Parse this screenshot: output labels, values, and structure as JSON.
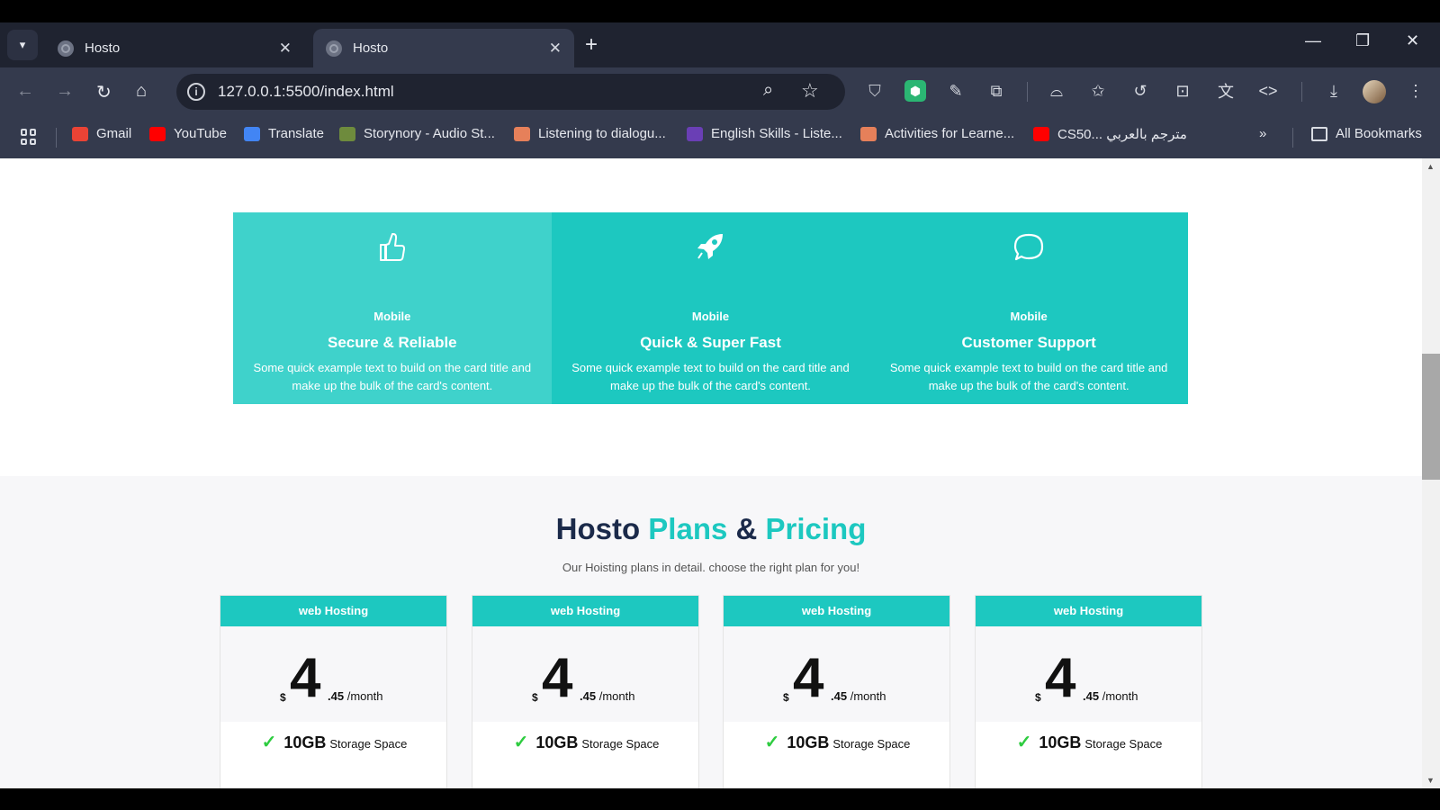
{
  "browser": {
    "tabs": [
      {
        "title": "Hosto"
      },
      {
        "title": "Hosto"
      }
    ],
    "url": "127.0.0.1:5500/index.html",
    "bookmarks": [
      {
        "label": "Gmail"
      },
      {
        "label": "YouTube"
      },
      {
        "label": "Translate"
      },
      {
        "label": "Storynory - Audio St..."
      },
      {
        "label": "Listening to dialogu..."
      },
      {
        "label": "English Skills - Liste..."
      },
      {
        "label": "Activities for Learne..."
      },
      {
        "label": "CS50... مترجم بالعربي"
      }
    ],
    "all_bookmarks": "All Bookmarks"
  },
  "features": [
    {
      "icon": "thumbs-up-icon",
      "subtitle": "Mobile",
      "title": "Secure & Reliable",
      "text": "Some quick example text to build on the card title and make up the bulk of the card's content."
    },
    {
      "icon": "rocket-icon",
      "subtitle": "Mobile",
      "title": "Quick & Super Fast",
      "text": "Some quick example text to build on the card title and make up the bulk of the card's content."
    },
    {
      "icon": "chat-bubble-icon",
      "subtitle": "Mobile",
      "title": "Customer Support",
      "text": "Some quick example text to build on the card title and make up the bulk of the card's content."
    }
  ],
  "pricing": {
    "heading_part1": "Hosto ",
    "heading_part2": "Plans",
    "heading_part3": " & ",
    "heading_part4": "Pricing",
    "subheading": "Our Hoisting plans in detail. choose the right plan for you!",
    "plans": [
      {
        "name": "web Hosting",
        "currency": "$",
        "price": "4",
        "cents": ".45",
        "period": "/month",
        "storage": "10GB",
        "storage_label": "Storage Space"
      },
      {
        "name": "web Hosting",
        "currency": "$",
        "price": "4",
        "cents": ".45",
        "period": "/month",
        "storage": "10GB",
        "storage_label": "Storage Space"
      },
      {
        "name": "web Hosting",
        "currency": "$",
        "price": "4",
        "cents": ".45",
        "period": "/month",
        "storage": "10GB",
        "storage_label": "Storage Space"
      },
      {
        "name": "web Hosting",
        "currency": "$",
        "price": "4",
        "cents": ".45",
        "period": "/month",
        "storage": "10GB",
        "storage_label": "Storage Space"
      }
    ]
  },
  "colors": {
    "accent": "#1dc8c0",
    "heading_dark": "#1b2a4a",
    "browser_frame": "#343a4d"
  }
}
